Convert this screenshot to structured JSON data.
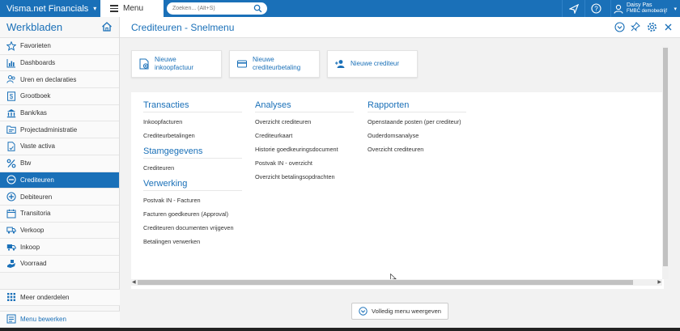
{
  "topbar": {
    "brand": "Visma.net Financials",
    "menu_label": "Menu",
    "search_placeholder": "Zoeken... (Alt+S)",
    "user_name": "Daisy Pas",
    "user_company": "FMBC demobedrijf"
  },
  "sidebar": {
    "title": "Werkbladen",
    "items": [
      {
        "label": "Favorieten",
        "icon": "star-icon"
      },
      {
        "label": "Dashboards",
        "icon": "bar-chart-icon"
      },
      {
        "label": "Uren en declaraties",
        "icon": "people-icon"
      },
      {
        "label": "Grootboek",
        "icon": "dollar-book-icon"
      },
      {
        "label": "Bank/kas",
        "icon": "bank-icon"
      },
      {
        "label": "Projectadministratie",
        "icon": "folder-icon"
      },
      {
        "label": "Vaste activa",
        "icon": "document-icon"
      },
      {
        "label": "Btw",
        "icon": "percent-icon"
      },
      {
        "label": "Crediteuren",
        "icon": "minus-circle-icon"
      },
      {
        "label": "Debiteuren",
        "icon": "plus-circle-icon"
      },
      {
        "label": "Transitoria",
        "icon": "calendar-icon"
      },
      {
        "label": "Verkoop",
        "icon": "truck-icon"
      },
      {
        "label": "Inkoop",
        "icon": "delivery-icon"
      },
      {
        "label": "Voorraad",
        "icon": "hand-icon"
      }
    ],
    "more": "Meer onderdelen",
    "edit": "Menu bewerken",
    "active_color": "#1a70b8"
  },
  "main": {
    "title": "Crediteuren - Snelmenu",
    "quick_actions": [
      {
        "label": "Nieuwe inkoopfactuur",
        "icon": "invoice-icon"
      },
      {
        "label": "Nieuwe crediteurbetaling",
        "icon": "card-icon"
      },
      {
        "label": "Nieuwe crediteur",
        "icon": "add-user-icon"
      }
    ],
    "columns": {
      "transacties": {
        "title": "Transacties",
        "links": [
          "Inkoopfacturen",
          "Crediteurbetalingen"
        ]
      },
      "stamgegevens": {
        "title": "Stamgegevens",
        "links": [
          "Crediteuren"
        ]
      },
      "verwerking": {
        "title": "Verwerking",
        "links": [
          "Postvak IN - Facturen",
          "Facturen goedkeuren (Approval)",
          "Crediteuren documenten vrijgeven",
          "Betalingen verwerken"
        ]
      },
      "analyses": {
        "title": "Analyses",
        "links": [
          "Overzicht crediteuren",
          "Crediteurkaart",
          "Historie goedkeuringsdocument",
          "Postvak IN - overzicht",
          "Overzicht betalingsopdrachten"
        ]
      },
      "rapporten": {
        "title": "Rapporten",
        "links": [
          "Openstaande posten (per crediteur)",
          "Ouderdomsanalyse",
          "Overzicht crediteuren"
        ]
      }
    },
    "full_menu_label": "Volledig menu weergeven"
  }
}
